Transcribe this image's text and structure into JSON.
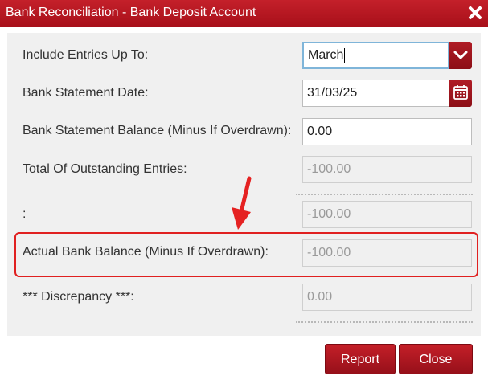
{
  "window": {
    "title": "Bank Reconciliation - Bank Deposit Account"
  },
  "form": {
    "include_entries_label": "Include Entries Up To:",
    "include_entries_value": "March",
    "statement_date_label": "Bank Statement Date:",
    "statement_date_value": "31/03/25",
    "statement_balance_label": "Bank Statement Balance (Minus If Overdrawn):",
    "statement_balance_value": "0.00",
    "outstanding_label": "Total Of Outstanding Entries:",
    "outstanding_value": "-100.00",
    "colon_label": ":",
    "colon_value": "-100.00",
    "actual_balance_label": "Actual Bank Balance (Minus If Overdrawn):",
    "actual_balance_value": "-100.00",
    "discrepancy_label": "*** Discrepancy ***:",
    "discrepancy_value": "0.00"
  },
  "buttons": {
    "report": "Report",
    "close": "Close"
  },
  "icons": {
    "close": "close-icon",
    "dropdown": "chevron-down-icon",
    "calendar": "calendar-icon",
    "arrow": "arrow-annotation"
  },
  "colors": {
    "brand": "#b0151f",
    "highlight": "#e02020",
    "focus": "#7fb5d9"
  }
}
